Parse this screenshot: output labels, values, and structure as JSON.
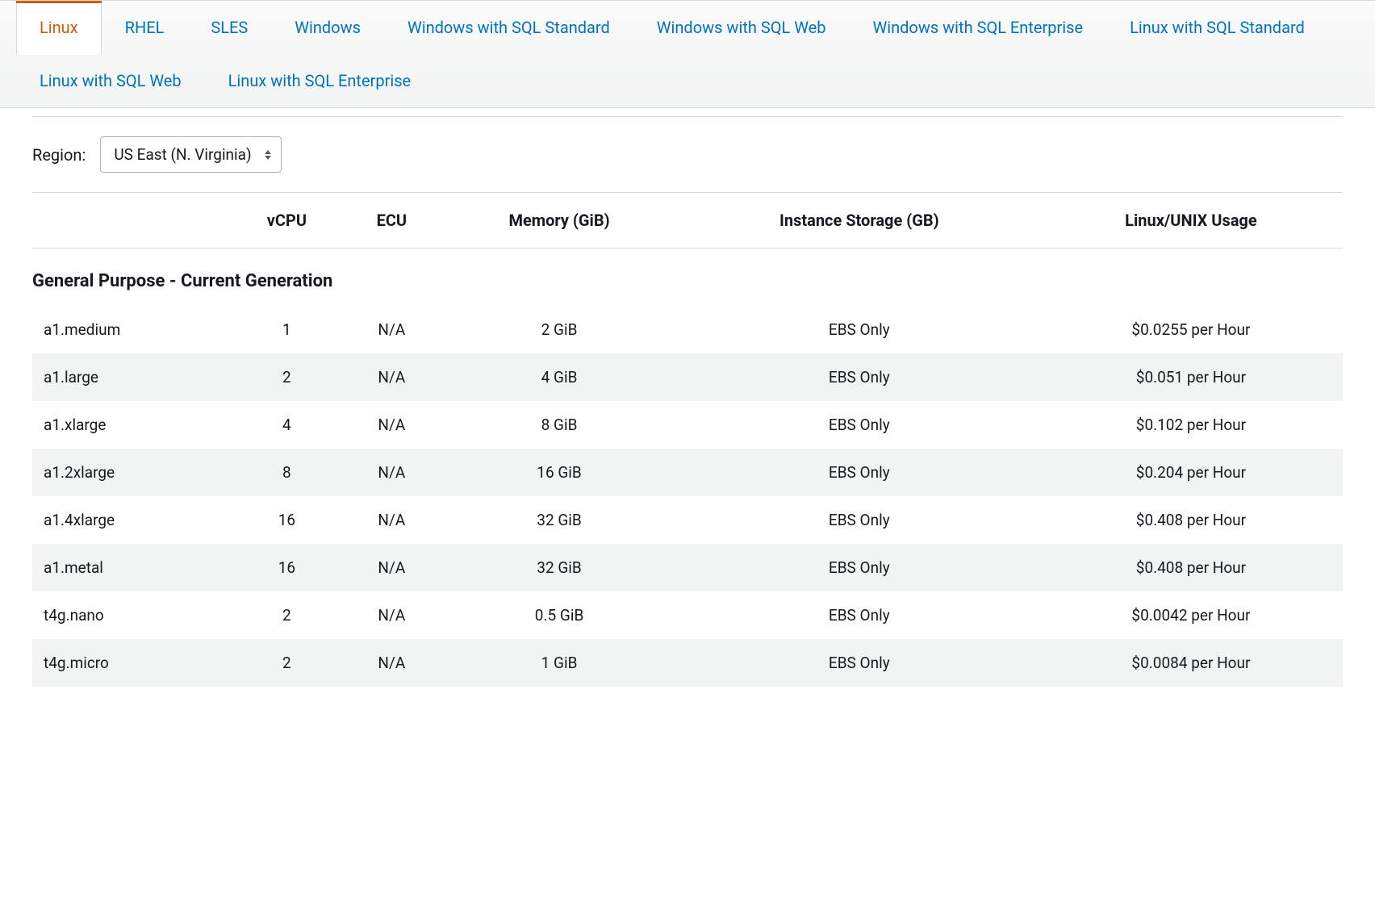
{
  "tabs": [
    {
      "label": "Linux",
      "active": true
    },
    {
      "label": "RHEL",
      "active": false
    },
    {
      "label": "SLES",
      "active": false
    },
    {
      "label": "Windows",
      "active": false
    },
    {
      "label": "Windows with SQL Standard",
      "active": false
    },
    {
      "label": "Windows with SQL Web",
      "active": false
    },
    {
      "label": "Windows with SQL Enterprise",
      "active": false
    },
    {
      "label": "Linux with SQL Standard",
      "active": false
    },
    {
      "label": "Linux with SQL Web",
      "active": false
    },
    {
      "label": "Linux with SQL Enterprise",
      "active": false
    }
  ],
  "region": {
    "label": "Region:",
    "selected": "US East (N. Virginia)"
  },
  "columns": [
    "",
    "vCPU",
    "ECU",
    "Memory (GiB)",
    "Instance Storage (GB)",
    "Linux/UNIX Usage"
  ],
  "section_title": "General Purpose - Current Generation",
  "rows": [
    {
      "name": "a1.medium",
      "vcpu": "1",
      "ecu": "N/A",
      "memory": "2 GiB",
      "storage": "EBS Only",
      "price": "$0.0255 per Hour"
    },
    {
      "name": "a1.large",
      "vcpu": "2",
      "ecu": "N/A",
      "memory": "4 GiB",
      "storage": "EBS Only",
      "price": "$0.051 per Hour"
    },
    {
      "name": "a1.xlarge",
      "vcpu": "4",
      "ecu": "N/A",
      "memory": "8 GiB",
      "storage": "EBS Only",
      "price": "$0.102 per Hour"
    },
    {
      "name": "a1.2xlarge",
      "vcpu": "8",
      "ecu": "N/A",
      "memory": "16 GiB",
      "storage": "EBS Only",
      "price": "$0.204 per Hour"
    },
    {
      "name": "a1.4xlarge",
      "vcpu": "16",
      "ecu": "N/A",
      "memory": "32 GiB",
      "storage": "EBS Only",
      "price": "$0.408 per Hour"
    },
    {
      "name": "a1.metal",
      "vcpu": "16",
      "ecu": "N/A",
      "memory": "32 GiB",
      "storage": "EBS Only",
      "price": "$0.408 per Hour"
    },
    {
      "name": "t4g.nano",
      "vcpu": "2",
      "ecu": "N/A",
      "memory": "0.5 GiB",
      "storage": "EBS Only",
      "price": "$0.0042 per Hour"
    },
    {
      "name": "t4g.micro",
      "vcpu": "2",
      "ecu": "N/A",
      "memory": "1 GiB",
      "storage": "EBS Only",
      "price": "$0.0084 per Hour"
    }
  ]
}
